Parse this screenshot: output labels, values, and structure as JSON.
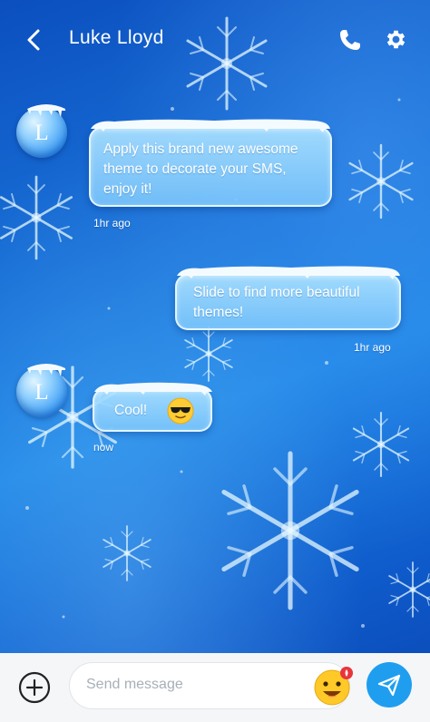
{
  "header": {
    "contact_name": "Luke Lloyd"
  },
  "messages": [
    {
      "direction": "incoming",
      "avatar_letter": "L",
      "text_lines": [
        "Apply this brand new awesome",
        "theme to decorate your SMS,",
        "enjoy it!"
      ],
      "time": "1hr ago"
    },
    {
      "direction": "outgoing",
      "text_lines": [
        "Slide to find more beautiful",
        "themes!"
      ],
      "time": "1hr ago"
    },
    {
      "direction": "incoming",
      "avatar_letter": "L",
      "text": "Cool!",
      "emoji": "sunglasses-emoji",
      "time": "now"
    }
  ],
  "composer": {
    "placeholder": "Send message"
  },
  "colors": {
    "background_top": "#0b4fbf",
    "background_mid": "#1f86e6",
    "send_button": "#1f9ef0",
    "bottom_bar": "#f4f6f8",
    "badge": "#e8353b"
  },
  "icons": [
    "back-arrow-icon",
    "phone-icon",
    "gear-icon",
    "plus-circle-icon",
    "emoji-sticker-icon",
    "send-plane-icon"
  ]
}
